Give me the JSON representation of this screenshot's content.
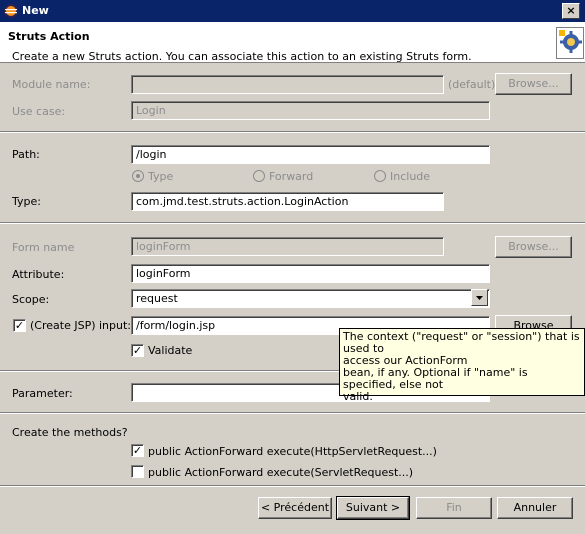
{
  "window": {
    "title": "New"
  },
  "banner": {
    "heading": "Struts Action",
    "description": "Create a new Struts action. You can associate this action to an existing Struts form."
  },
  "form": {
    "module_name_label": "Module name:",
    "module_name_value": "",
    "default_label": "(default)",
    "browse_label": "Browse...",
    "use_case_label": "Use case:",
    "use_case_value": "Login",
    "path_label": "Path:",
    "path_value": "/login",
    "radio_type": "Type",
    "radio_forward": "Forward",
    "radio_include": "Include",
    "type_label": "Type:",
    "type_value": "com.jmd.test.struts.action.LoginAction",
    "form_name_label": "Form name",
    "form_name_value": "loginForm",
    "attribute_label": "Attribute:",
    "attribute_value": "loginForm",
    "scope_label": "Scope:",
    "scope_value": "request",
    "create_jsp_label": "(Create JSP) input:",
    "input_value": "/form/login.jsp",
    "browse_partial": "Browse",
    "validate_label": "Validate",
    "parameter_label": "Parameter:",
    "parameter_value": "",
    "create_methods_label": "Create the methods?",
    "method1": "public ActionForward execute(HttpServletRequest...)",
    "method2": "public ActionForward execute(ServletRequest...)"
  },
  "tooltip": {
    "lines": [
      "The context (\"request\" or \"session\") that is used to",
      "access our ActionForm",
      "bean, if any. Optional if \"name\" is",
      "specified, else not",
      "valid."
    ]
  },
  "buttons": {
    "back": "< Précédent",
    "next": "Suivant >",
    "finish": "Fin",
    "cancel": "Annuler"
  },
  "icons": {
    "window": "eclipse-icon",
    "banner": "struts-gear-icon",
    "close": "close-icon",
    "dropdown": "chevron-down-icon",
    "check": "checkmark-icon"
  }
}
